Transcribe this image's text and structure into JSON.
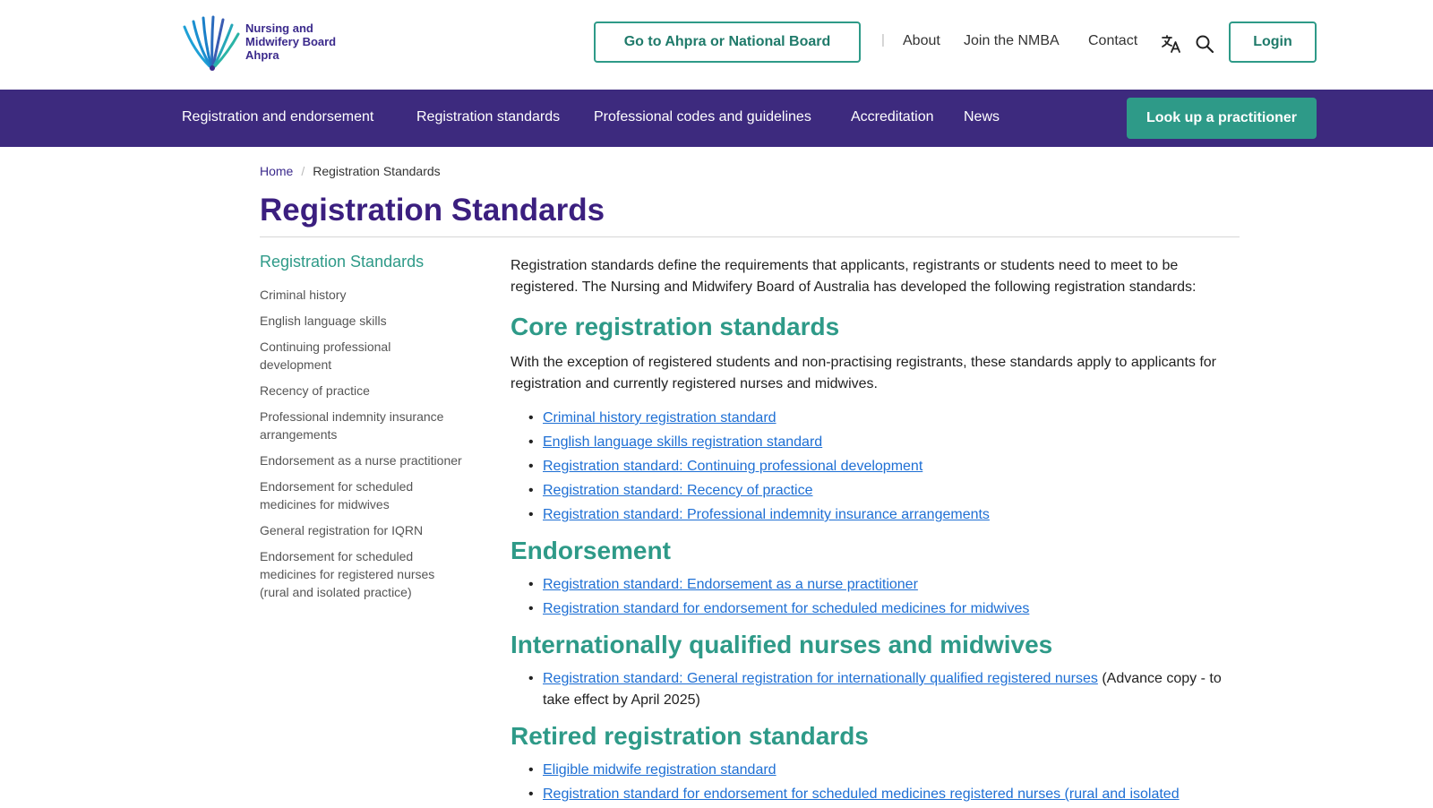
{
  "header": {
    "logo_lines": [
      "Nursing and",
      "Midwifery Board",
      "Ahpra"
    ],
    "ahpra_button": "Go to Ahpra or National Board",
    "separator": "|",
    "links": [
      "About",
      "Join the NMBA",
      "Contact"
    ],
    "login_button": "Login",
    "icons": [
      "translate-icon",
      "search-icon"
    ]
  },
  "nav": {
    "items": [
      "Registration and endorsement",
      "Registration standards",
      "Professional codes and guidelines",
      "Accreditation",
      "News"
    ],
    "lookup_button": "Look up a practitioner"
  },
  "breadcrumb": {
    "home": "Home",
    "separator": "/",
    "current": "Registration Standards"
  },
  "page_title": "Registration Standards",
  "sidebar": {
    "heading": "Registration Standards",
    "items": [
      "Criminal history",
      "English language skills",
      "Continuing professional development",
      "Recency of practice",
      "Professional indemnity insurance arrangements",
      "Endorsement as a nurse practitioner",
      "Endorsement for scheduled medicines for midwives",
      "General registration for IQRN",
      "Endorsement for scheduled medicines for registered nurses (rural and isolated practice)"
    ]
  },
  "main": {
    "intro": "Registration standards define the requirements that applicants, registrants or students need to meet to be registered. The Nursing and Midwifery Board of Australia has developed the following registration standards:",
    "core": {
      "heading": "Core registration standards",
      "text": "With the exception of registered students and non-practising registrants, these standards apply to applicants for registration and currently registered nurses and midwives.",
      "links": [
        "Criminal history registration standard",
        "English language skills registration standard",
        "Registration standard: Continuing professional development",
        "Registration standard: Recency of practice",
        "Registration standard: Professional indemnity insurance arrangements"
      ]
    },
    "endorsement": {
      "heading": "Endorsement",
      "links": [
        "Registration standard: Endorsement as a nurse practitioner",
        "Registration standard for endorsement for scheduled medicines for midwives"
      ]
    },
    "iq": {
      "heading": "Internationally qualified nurses and midwives",
      "link": "Registration standard: General registration for internationally qualified registered nurses",
      "note": " (Advance copy - to take effect by April 2025)"
    },
    "retired": {
      "heading": "Retired registration standards",
      "links": [
        "Eligible midwife registration standard",
        "Registration standard for endorsement for scheduled medicines registered nurses (rural and isolated"
      ]
    }
  },
  "colors": {
    "nav_bg": "#3d2a7e",
    "title": "#3b1f7f",
    "teal": "#2e9a88",
    "link": "#1e6fd4"
  }
}
